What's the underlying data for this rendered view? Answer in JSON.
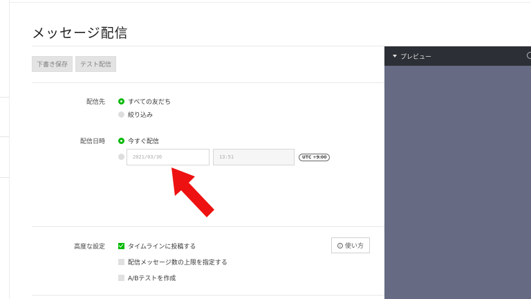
{
  "page": {
    "title": "メッセージ配信"
  },
  "toolbar": {
    "save_draft": "下書き保存",
    "test_send": "テスト配信"
  },
  "recipients": {
    "label": "配信先",
    "options": [
      {
        "label": "すべての友だち",
        "selected": true
      },
      {
        "label": "絞り込み",
        "selected": false
      }
    ]
  },
  "schedule": {
    "label": "配信日時",
    "now_label": "今すぐ配信",
    "date_value": "2021/03/30",
    "time_value": "13:51",
    "timezone": "UTC +9:00"
  },
  "advanced": {
    "label": "高度な設定",
    "options": [
      {
        "label": "タイムラインに投稿する",
        "checked": true
      },
      {
        "label": "配信メッセージ数の上限を指定する",
        "checked": false
      },
      {
        "label": "A/Bテストを作成",
        "checked": false
      }
    ],
    "help_label": "使い方"
  },
  "preview": {
    "title": "プレビュー",
    "background_color": "#666a82"
  },
  "colors": {
    "accent": "#00b900",
    "annotation_arrow": "#ee1111"
  }
}
